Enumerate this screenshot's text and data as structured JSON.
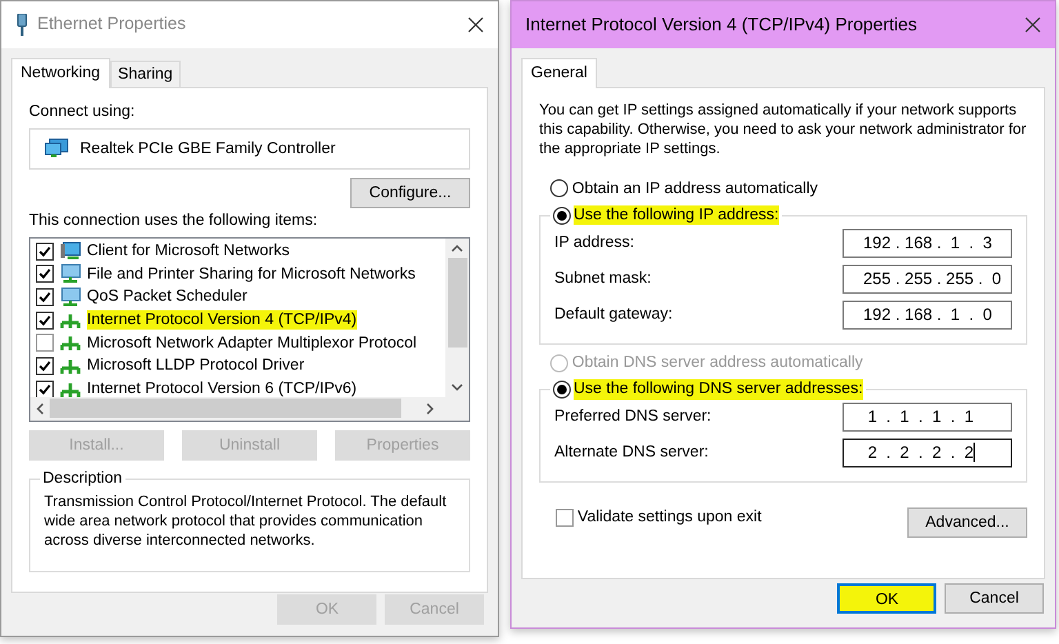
{
  "ethernet_window": {
    "title": "Ethernet Properties",
    "tabs": [
      {
        "label": "Networking",
        "selected": true
      },
      {
        "label": "Sharing",
        "selected": false
      }
    ],
    "connect_using_label": "Connect using:",
    "adapter": "Realtek PCIe GBE Family Controller",
    "configure_button": "Configure...",
    "items_label": "This connection uses the following items:",
    "items": [
      {
        "label": "Client for Microsoft Networks",
        "kind": "client",
        "checked": true,
        "highlighted": false
      },
      {
        "label": "File and Printer Sharing for Microsoft Networks",
        "kind": "service",
        "checked": true,
        "highlighted": false
      },
      {
        "label": "QoS Packet Scheduler",
        "kind": "service",
        "checked": true,
        "highlighted": false
      },
      {
        "label": "Internet Protocol Version 4 (TCP/IPv4)",
        "kind": "protocol",
        "checked": true,
        "highlighted": true
      },
      {
        "label": "Microsoft Network Adapter Multiplexor Protocol",
        "kind": "protocol",
        "checked": false,
        "highlighted": false
      },
      {
        "label": "Microsoft LLDP Protocol Driver",
        "kind": "protocol",
        "checked": true,
        "highlighted": false
      },
      {
        "label": "Internet Protocol Version 6 (TCP/IPv6)",
        "kind": "protocol",
        "checked": true,
        "highlighted": false
      }
    ],
    "action_buttons": [
      {
        "label": "Install...",
        "disabled": true
      },
      {
        "label": "Uninstall",
        "disabled": true
      },
      {
        "label": "Properties",
        "disabled": true
      }
    ],
    "description_title": "Description",
    "description": "Transmission Control Protocol/Internet Protocol. The default wide area network protocol that provides communication across diverse interconnected networks.",
    "buttons": [
      {
        "label": "OK",
        "disabled": true
      },
      {
        "label": "Cancel",
        "disabled": true
      }
    ]
  },
  "ipv4_window": {
    "title": "Internet Protocol Version 4 (TCP/IPv4) Properties",
    "tabs": [
      {
        "label": "General",
        "selected": true
      }
    ],
    "intro": "You can get IP settings assigned automatically if your network supports this capability. Otherwise, you need to ask your network administrator for the appropriate IP settings.",
    "ip_options": [
      {
        "label": "Obtain an IP address automatically",
        "selected": false,
        "disabled": false,
        "highlighted": false
      },
      {
        "label": "Use the following IP address:",
        "selected": true,
        "disabled": false,
        "highlighted": true
      }
    ],
    "ip_fields": [
      {
        "label": "IP address:",
        "value": "192 . 168 .  1  .  3",
        "focused": false
      },
      {
        "label": "Subnet mask:",
        "value": "255 . 255 . 255 .  0",
        "focused": false
      },
      {
        "label": "Default gateway:",
        "value": "192 . 168 .  1  .  0",
        "focused": false
      }
    ],
    "dns_options": [
      {
        "label": "Obtain DNS server address automatically",
        "selected": false,
        "disabled": true,
        "highlighted": false
      },
      {
        "label": "Use the following DNS server addresses:",
        "selected": true,
        "disabled": false,
        "highlighted": true
      }
    ],
    "dns_fields": [
      {
        "label": "Preferred DNS server:",
        "value": " 1  .  1  .  1  .  1",
        "focused": false
      },
      {
        "label": "Alternate DNS server:",
        "value": " 2  .  2  .  2  .  2",
        "focused": true
      }
    ],
    "validate": {
      "label": "Validate settings upon exit",
      "checked": false
    },
    "advanced_button": "Advanced...",
    "buttons": [
      {
        "label": "OK",
        "default": true,
        "highlighted": true
      },
      {
        "label": "Cancel",
        "default": false,
        "highlighted": false
      }
    ]
  }
}
